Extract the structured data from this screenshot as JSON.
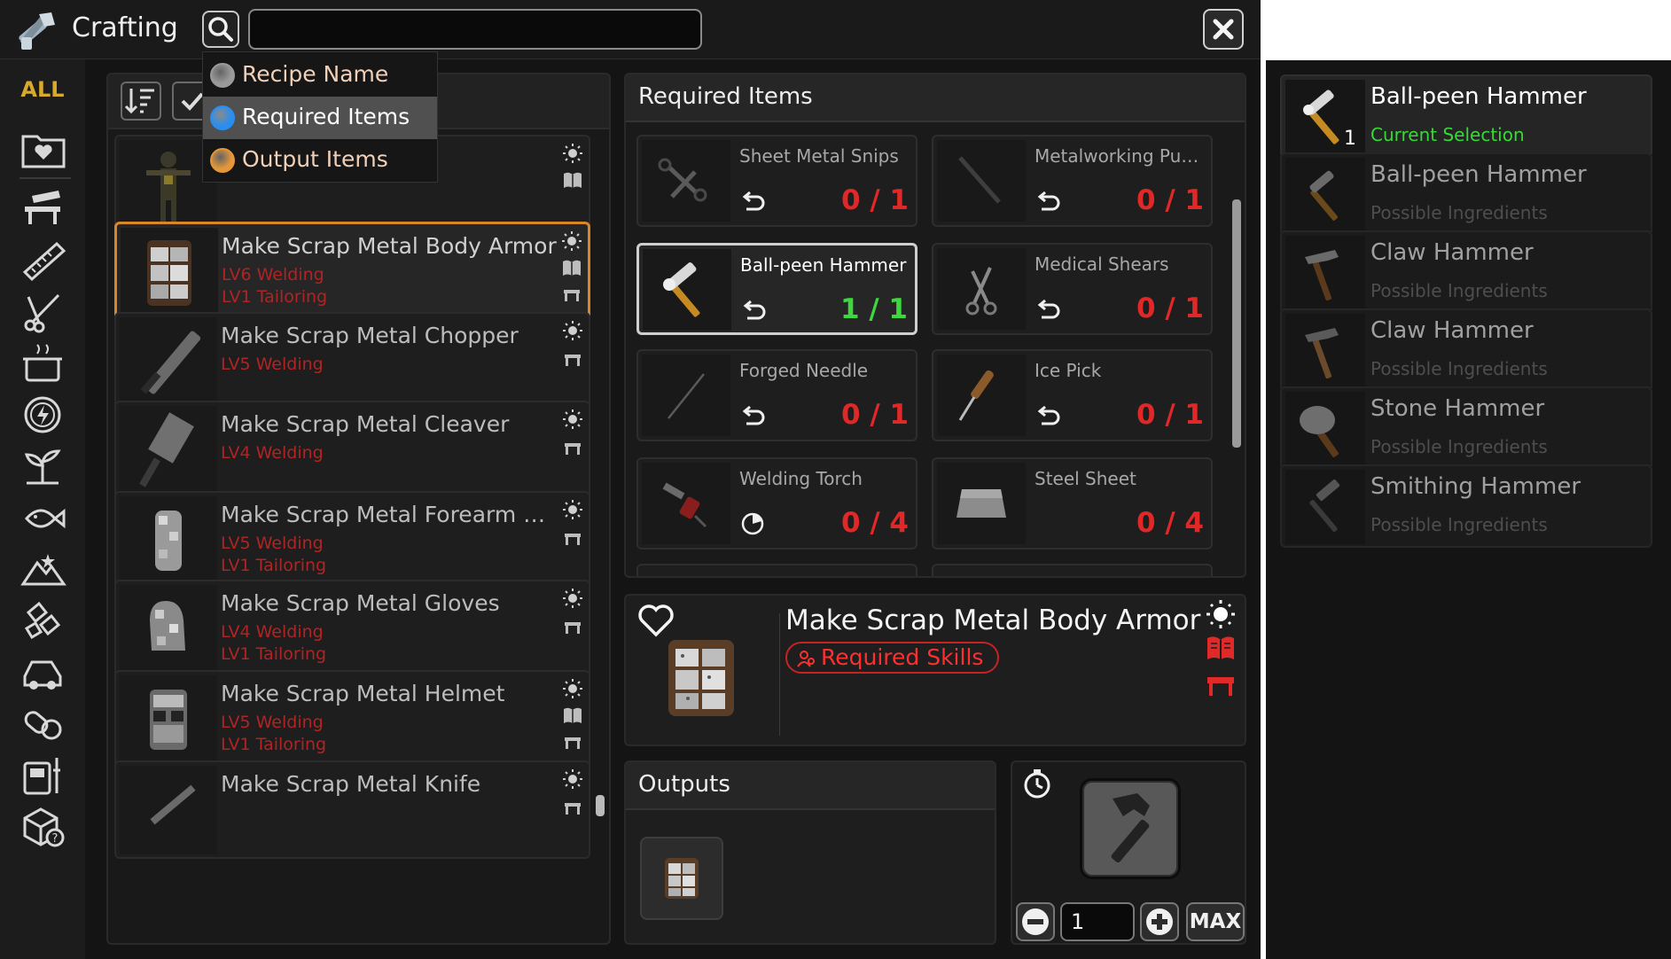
{
  "window": {
    "title": "Crafting",
    "title_icon": "crafting-hammer-icon",
    "close_icon": "close-icon"
  },
  "search": {
    "value": "",
    "placeholder": "",
    "icon": "search-icon"
  },
  "search_filter_dropdown": {
    "options": [
      {
        "label": "Recipe Name",
        "color": "#9a9a9a"
      },
      {
        "label": "Required Items",
        "color": "#2a8ef0"
      },
      {
        "label": "Output Items",
        "color": "#e3963a"
      }
    ],
    "selected_index": 1
  },
  "categories": {
    "all_label": "ALL",
    "icons": [
      "favorites-folder-icon",
      "workbench-icon",
      "saw-icon",
      "scissors-icon",
      "cooking-pot-icon",
      "electricity-icon",
      "farming-icon",
      "fishing-icon",
      "survival-icon",
      "ammo-icon",
      "vehicle-icon",
      "medical-icon",
      "electronics-icon",
      "misc-box-icon"
    ]
  },
  "recipe_list": {
    "toolbar_icons": [
      "sort-icon",
      "checkmark-filter-icon"
    ],
    "recipes": [
      {
        "name": "",
        "requirements": [],
        "status_icons": [
          "light-icon",
          "book-icon"
        ]
      },
      {
        "name": "Make Scrap Metal Body Armor",
        "requirements": [
          "LV6 Welding",
          "LV1 Tailoring"
        ],
        "status_icons": [
          "light-icon",
          "book-icon",
          "workbench-icon"
        ],
        "selected": true
      },
      {
        "name": "Make Scrap Metal Chopper",
        "requirements": [
          "LV5 Welding"
        ],
        "status_icons": [
          "light-icon",
          "workbench-icon"
        ]
      },
      {
        "name": "Make Scrap Metal Cleaver",
        "requirements": [
          "LV4 Welding"
        ],
        "status_icons": [
          "light-icon",
          "workbench-icon"
        ]
      },
      {
        "name": "Make Scrap Metal Forearm Ar...",
        "requirements": [
          "LV5 Welding",
          "LV1 Tailoring"
        ],
        "status_icons": [
          "light-icon",
          "workbench-icon"
        ]
      },
      {
        "name": "Make Scrap Metal Gloves",
        "requirements": [
          "LV4 Welding",
          "LV1 Tailoring"
        ],
        "status_icons": [
          "light-icon",
          "workbench-icon"
        ]
      },
      {
        "name": "Make Scrap Metal Helmet",
        "requirements": [
          "LV5 Welding",
          "LV1 Tailoring"
        ],
        "status_icons": [
          "light-icon",
          "book-icon",
          "workbench-icon"
        ]
      },
      {
        "name": "Make Scrap Metal Knife",
        "requirements": [],
        "status_icons": [
          "light-icon",
          "workbench-icon"
        ]
      }
    ]
  },
  "required_items": {
    "title": "Required Items",
    "items": [
      {
        "name": "Sheet Metal Snips",
        "count": "0 / 1",
        "icon": "return-icon",
        "item_icon": "snips-icon"
      },
      {
        "name": "Metalworking Pun...",
        "count": "0 / 1",
        "icon": "return-icon",
        "item_icon": "punch-icon"
      },
      {
        "name": "Ball-peen Hammer",
        "count": "1 / 1",
        "icon": "return-icon",
        "item_icon": "hammer-icon",
        "selected": true
      },
      {
        "name": "Medical Shears",
        "count": "0 / 1",
        "icon": "return-icon",
        "item_icon": "shears-icon"
      },
      {
        "name": "Forged Needle",
        "count": "0 / 1",
        "icon": "return-icon",
        "item_icon": "needle-icon"
      },
      {
        "name": "Ice Pick",
        "count": "0 / 1",
        "icon": "return-icon",
        "item_icon": "ice-pick-icon"
      },
      {
        "name": "Welding Torch",
        "count": "0 / 4",
        "icon": "partial-use-icon",
        "item_icon": "torch-icon"
      },
      {
        "name": "Steel Sheet",
        "count": "0 / 4",
        "icon": "",
        "item_icon": "steel-sheet-icon"
      }
    ]
  },
  "recipe_detail": {
    "name": "Make Scrap Metal Body Armor",
    "required_skills_label": "Required Skills",
    "icons": [
      "favorite-heart-icon",
      "light-icon",
      "book-icon",
      "workbench-icon"
    ],
    "accent": "#e02a2a"
  },
  "outputs": {
    "title": "Outputs",
    "item_icon": "scrap-metal-body-armor-icon"
  },
  "craft": {
    "quantity": "1",
    "max_label": "MAX",
    "icons": [
      "timer-icon",
      "craft-hammer-icon",
      "minus-icon",
      "plus-icon"
    ]
  },
  "ingredient_sources": [
    {
      "name": "Ball-peen Hammer",
      "subtitle": "Current Selection",
      "quantity": "1",
      "current": true
    },
    {
      "name": "Ball-peen Hammer",
      "subtitle": "Possible Ingredients"
    },
    {
      "name": "Claw Hammer",
      "subtitle": "Possible Ingredients"
    },
    {
      "name": "Claw Hammer",
      "subtitle": "Possible Ingredients"
    },
    {
      "name": "Stone Hammer",
      "subtitle": "Possible Ingredients"
    },
    {
      "name": "Smithing Hammer",
      "subtitle": "Possible Ingredients"
    }
  ],
  "colors": {
    "selection_orange": "#d8862a",
    "requirement_red": "#b02424",
    "count_red": "#e02828",
    "count_green": "#3dd83d",
    "all_gold": "#d8a92a"
  }
}
